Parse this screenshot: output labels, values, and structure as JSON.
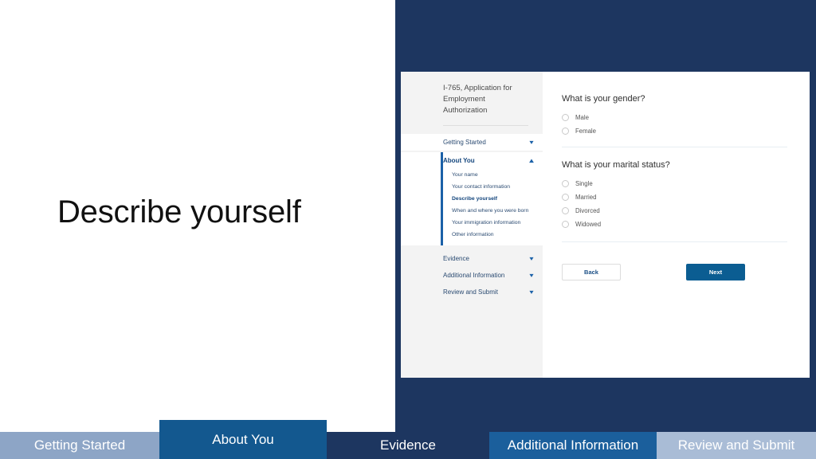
{
  "slide": {
    "headline": "Describe yourself"
  },
  "app": {
    "form_title": "I-765, Application for Employment Authorization",
    "sidebar": {
      "sections": [
        {
          "label": "Getting Started",
          "icon": "chevron-down-icon",
          "state": "collapsed"
        },
        {
          "label": "About You",
          "icon": "chevron-up-icon",
          "state": "expanded"
        }
      ],
      "about_you_items": [
        "Your name",
        "Your contact information",
        "Describe yourself",
        "When and where you were born",
        "Your immigration information",
        "Other information"
      ],
      "current_item": "Describe yourself",
      "bottom_sections": [
        {
          "label": "Evidence",
          "icon": "chevron-down-icon"
        },
        {
          "label": "Additional Information",
          "icon": "chevron-down-icon"
        },
        {
          "label": "Review and Submit",
          "icon": "chevron-down-icon"
        }
      ]
    },
    "main": {
      "masked_heading": "",
      "gender": {
        "question": "What is your gender?",
        "options": [
          "Male",
          "Female"
        ],
        "selected": ""
      },
      "marital": {
        "question": "What is your marital status?",
        "options": [
          "Single",
          "Married",
          "Divorced",
          "Widowed"
        ],
        "selected": ""
      },
      "buttons": {
        "back": "Back",
        "next": "Next"
      }
    }
  },
  "tabstrip": {
    "tabs": [
      {
        "label": "Getting Started",
        "color": "#8da5c6",
        "active": false
      },
      {
        "label": "About You",
        "color": "#13588f",
        "active": true
      },
      {
        "label": "Evidence",
        "color": "#1d3660",
        "active": false
      },
      {
        "label": "Additional Information",
        "color": "#1b5f9c",
        "active": false
      },
      {
        "label": "Review and Submit",
        "color": "#a9bcd6",
        "active": false
      }
    ]
  },
  "colors": {
    "navy_panel": "#1d3660",
    "accent_blue": "#1b61a8",
    "next_button": "#0b5d92"
  }
}
